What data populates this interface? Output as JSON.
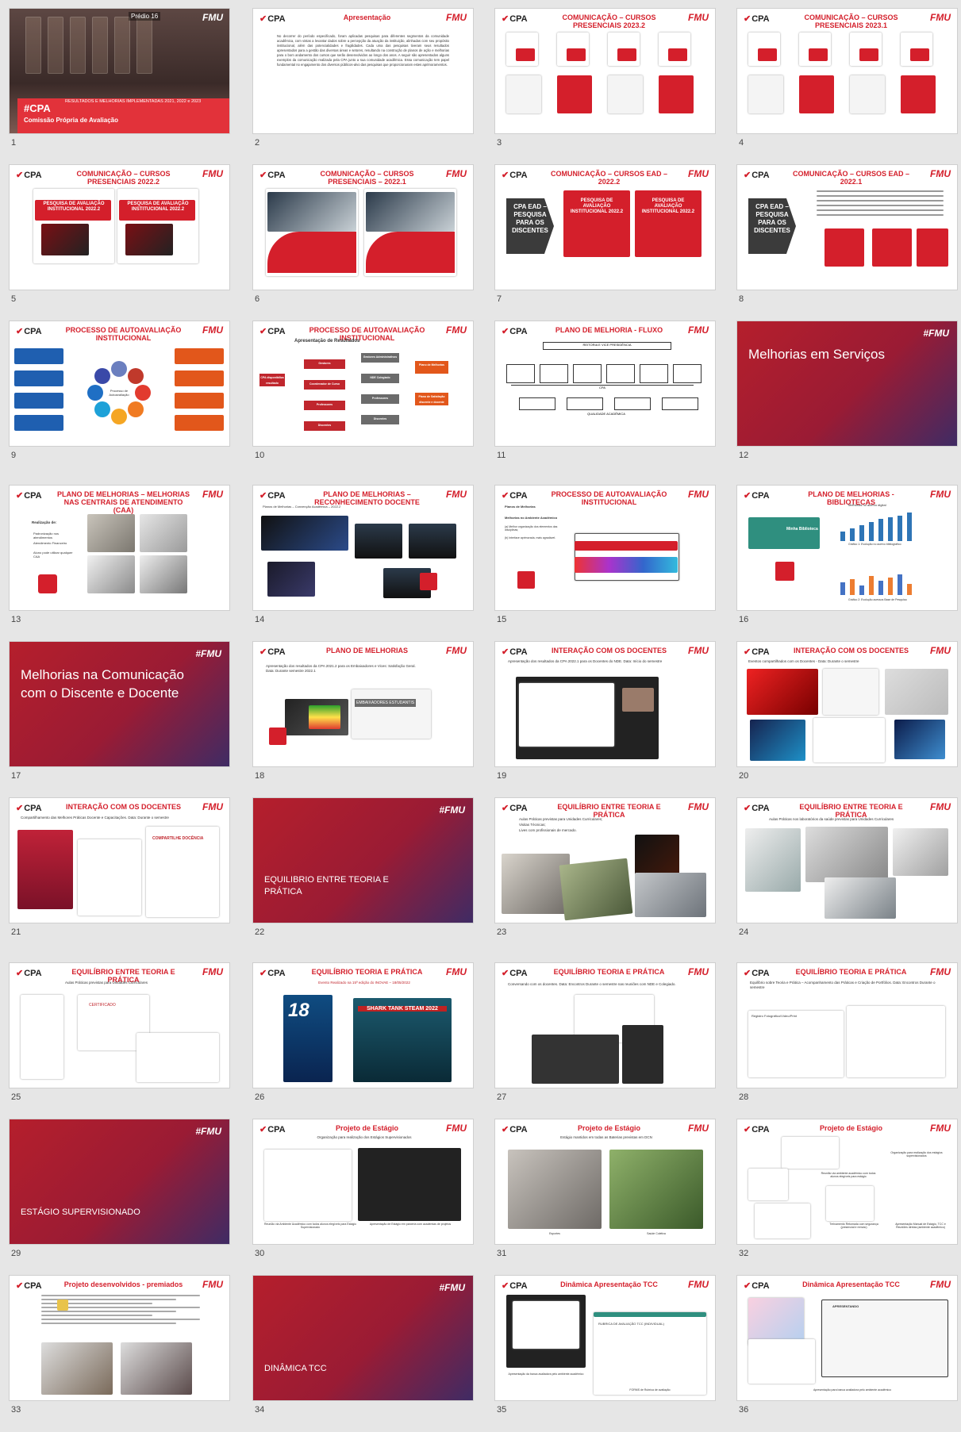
{
  "colors": {
    "accent": "#d41f2b",
    "section_bg": "#9a1b34",
    "background": "#e6e6e6"
  },
  "brand": {
    "cpa": "CPA",
    "fmu": "FMU",
    "hashfmu": "#FMU"
  },
  "slides": [
    {
      "num": "1",
      "kind": "cover",
      "tag": "#CPA",
      "line1": "RESULTADOS E MELHORIAS IMPLEMENTADAS 2021, 2022 e 2023",
      "line2": "Comissão Própria de Avaliação",
      "sign": "Prédio 16"
    },
    {
      "num": "2",
      "kind": "text",
      "title": "Apresentação",
      "body": "No decorrer do período especificado, foram aplicadas pesquisas para diferentes segmentos da comunidade acadêmica, com vistas a levantar dados sobre a percepção da atuação da instituição, alinhadas com seu propósito institucional, além das potencialidades e fragilidades. Cada uma das pesquisas tiveram seus resultados apresentados para a gestão das diversas áreas e setores, resultando na construção de planos de ação e melhorias para o bom andamento dos cursos que serão desenvolvidos ao longo dos anos. A seguir são apresentados alguns exemplos da comunicação realizada pela CPA junto a sua comunidade acadêmica. Essa comunicação tem papel fundamental no engajamento dos diversos públicos-alvo das pesquisas que proporcionaram estes aprimoramentos."
    },
    {
      "num": "3",
      "kind": "collage",
      "title": "COMUNICAÇÃO – CURSOS PRESENCIAIS 2023.2"
    },
    {
      "num": "4",
      "kind": "collage",
      "title": "COMUNICAÇÃO – CURSOS PRESENCIAIS 2023.1"
    },
    {
      "num": "5",
      "kind": "posters",
      "title": "COMUNICAÇÃO – CURSOS PRESENCIAIS 2022.2",
      "poster": "PESQUISA DE AVALIAÇÃO INSTITUCIONAL 2022.2"
    },
    {
      "num": "6",
      "kind": "posters2",
      "title": "COMUNICAÇÃO – CURSOS PRESENCIAIS – 2022.1"
    },
    {
      "num": "7",
      "kind": "ead",
      "title": "COMUNICAÇÃO – CURSOS EAD – 2022.2",
      "box": "CPA EAD – PESQUISA PARA OS DISCENTES",
      "poster": "PESQUISA DE AVALIAÇÃO INSTITUCIONAL 2022.2"
    },
    {
      "num": "8",
      "kind": "ead2",
      "title": "COMUNICAÇÃO – CURSOS EAD – 2022.1",
      "box": "CPA EAD – PESQUISA PARA OS DISCENTES"
    },
    {
      "num": "9",
      "kind": "cycle",
      "title": "PROCESSO DE AUTOAVALIAÇÃO INSTITUCIONAL",
      "center": "Processo de Autoavaliação"
    },
    {
      "num": "10",
      "kind": "tree",
      "title": "PROCESSO DE AUTOAVALIAÇÃO INSTITUCIONAL",
      "subtitle": "Apresentação de Resultados",
      "root": "CPA disponibiliza resultado",
      "nodes": [
        "Gestores",
        "Coordenador de Curso",
        "Professores",
        "Discentes"
      ],
      "leaves": [
        "Gestores Administrativos",
        "NDE Colegiado",
        "Professores",
        "Discentes"
      ],
      "ends": [
        "Plano de Melhorias",
        "Plano de Satisfação discente e docente"
      ]
    },
    {
      "num": "11",
      "kind": "flow",
      "title": "PLANO DE MELHORIA - FLUXO",
      "top": "REITORIA E VICE PRESIDÊNCIA",
      "mid": "CPA",
      "bottom": "QUALIDADE ACADÊMICA"
    },
    {
      "num": "12",
      "kind": "section",
      "title": "Melhorias em Serviços"
    },
    {
      "num": "13",
      "kind": "photos",
      "title": "PLANO DE MELHORIAS – MELHORIAS NAS CENTRAIS DE ATENDIMENTO (CAA)",
      "list_title": "Realização de:",
      "items": [
        "Padronização nos atendimentos",
        "Atendimento Financeiro",
        "Aluno pode utilizar qualquer CAA"
      ]
    },
    {
      "num": "14",
      "kind": "screens",
      "title": "PLANO DE MELHORIAS – RECONHECIMENTO DOCENTE",
      "subtitle": "Planos de Melhorias – Convenção Acadêmica – 2022.2"
    },
    {
      "num": "15",
      "kind": "screen1",
      "title": "PROCESSO DE AUTOAVALIAÇÃO INSTITUCIONAL",
      "subtitle": "Planos de Melhorias",
      "sub2": "Melhorias no Ambiente Acadêmico",
      "items": [
        "(a) Melhor organização dos elementos das disciplinas;",
        "(b) Interface aprimorada, mais agradável."
      ]
    },
    {
      "num": "16",
      "kind": "charts",
      "title": "PLANO DE MELHORIAS - BIBLIOTECAS",
      "subtitle": "Melhorias no acervo digital",
      "badge": "Minha Biblioteca",
      "cap1": "Gráfico 1: Evolução no acervo bibliográfico",
      "cap2": "Gráfico 2: Evolução acessos Base de Pesquisa"
    },
    {
      "num": "17",
      "kind": "section",
      "title": "Melhorias na Comunicação com o Discente e Docente"
    },
    {
      "num": "18",
      "kind": "shots",
      "title": "PLANO DE MELHORIAS",
      "body": "Apresentação dos resultados da CPA 2021.2 para os Embaixadores e Vices: Satisfação Geral. Data: Durante semestre 2022.1",
      "tag": "EMBAIXADORES ESTUDANTIS"
    },
    {
      "num": "19",
      "kind": "meet",
      "title": "INTERAÇÃO COM OS DOCENTES",
      "body": "Apresentação dos resultados da CPA 2022.1 para os Docentes do NDE. Data: Início do semestre"
    },
    {
      "num": "20",
      "kind": "events",
      "title": "INTERAÇÃO COM OS DOCENTES",
      "body": "Eventos compartilhados com os Docentes - Data: Durante o semestre"
    },
    {
      "num": "21",
      "kind": "pract",
      "title": "INTERAÇÃO COM OS DOCENTES",
      "body": "Compartilhamento das Melhores Práticas Docente e Capacitações. Data: Durante o semestre",
      "poster": "COMPARTILHE DOCÊNCIA"
    },
    {
      "num": "22",
      "kind": "section_low",
      "title": "EQUILIBRIO ENTRE TEORIA E PRÁTICA"
    },
    {
      "num": "23",
      "kind": "photos3",
      "title": "EQUILÍBRIO ENTRE TEORIA E PRÁTICA",
      "items": [
        "Aulas Práticas previstas para Unidades Curriculares;",
        "Visitas Técnicas;",
        "Lives com profissionais de mercado."
      ]
    },
    {
      "num": "24",
      "kind": "lab",
      "title": "EQUILÍBRIO ENTRE TEORIA E PRÁTICA",
      "body": "Aulas Práticas nos laboratórios da saúde previstas para Unidades Curriculares"
    },
    {
      "num": "25",
      "kind": "certs",
      "title": "EQUILÍBRIO ENTRE TEORIA E PRÁTICA",
      "body": "Aulas Práticas previstas para Unidades Curriculares",
      "cert": "CERTIFICADO"
    },
    {
      "num": "26",
      "kind": "inovae",
      "title": "EQUILÍBRIO TEORIA E PRÁTICA",
      "body": "Evento Realizado na 15ª edição do INOVAE – 18/05/2022",
      "shark": "SHARK TANK STEAM 2022",
      "n": "18"
    },
    {
      "num": "27",
      "kind": "meet2",
      "title": "EQUILÍBRIO TEORIA E PRÁTICA",
      "body": "Conversando com os docentes. Data: Encontros Durante o semestre nas reuniões com NDE e Colegiado."
    },
    {
      "num": "28",
      "kind": "portfolio",
      "title": "EQUILÍBRIO TEORIA E PRÁTICA",
      "body": "Equilíbrio sobre Teoria e Prática – Acompanhamento das Práticas e Criação de Portfólios. Data: Encontros Durante o semestre",
      "tag": "Registro Fotográfico/Vídeo/Print"
    },
    {
      "num": "29",
      "kind": "section_low",
      "title": "ESTÁGIO SUPERVISIONADO"
    },
    {
      "num": "30",
      "kind": "estagio",
      "title": "Projeto de Estágio",
      "body": "Organização para realização dos Estágios Supervisionados",
      "cap1": "Reunião via Ambiente Acadêmico com todos alunos elegíveis para Estágio Supervisionado",
      "cap2": "Apresentação de Estágio em parceria com academias de projetos"
    },
    {
      "num": "31",
      "kind": "estagio2",
      "title": "Projeto de Estágio",
      "body": "Estágio mantidos em todas as Baterias previstas em DCN",
      "cap1": "Esportes",
      "cap2": "Saúde Coletiva"
    },
    {
      "num": "32",
      "kind": "estagio3",
      "title": "Projeto de Estágio",
      "c1": "Organização para realização dos estágios supervisionados",
      "c2": "Reunião via ambiente acadêmico com todos alunos elegíveis para estágio",
      "c3": "Treinamento Retomada com segurança (presencial e remoto)",
      "c4": "Apresentação Manual de Estágio, TCC e Reuniões diretas (ambiente acadêmico)"
    },
    {
      "num": "33",
      "kind": "premiados",
      "title": "Projeto desenvolvidos - premiados"
    },
    {
      "num": "34",
      "kind": "section_low",
      "title": "DINÂMICA TCC"
    },
    {
      "num": "35",
      "kind": "tcc",
      "title": "Dinâmica Apresentação TCC",
      "cap1": "Apresentação da banca avaliadora pelo ambiente acadêmico",
      "cap2": "FORMS de Rubrica de avaliação",
      "form": "RUBRICA DE AVALIAÇÃO TCC (INDIVIDUAL)"
    },
    {
      "num": "36",
      "kind": "tcc2",
      "title": "Dinâmica Apresentação TCC",
      "cap": "Apresentação para banca avaliadora pelo ambiente acadêmico",
      "win": "APRESENTANDO"
    }
  ]
}
